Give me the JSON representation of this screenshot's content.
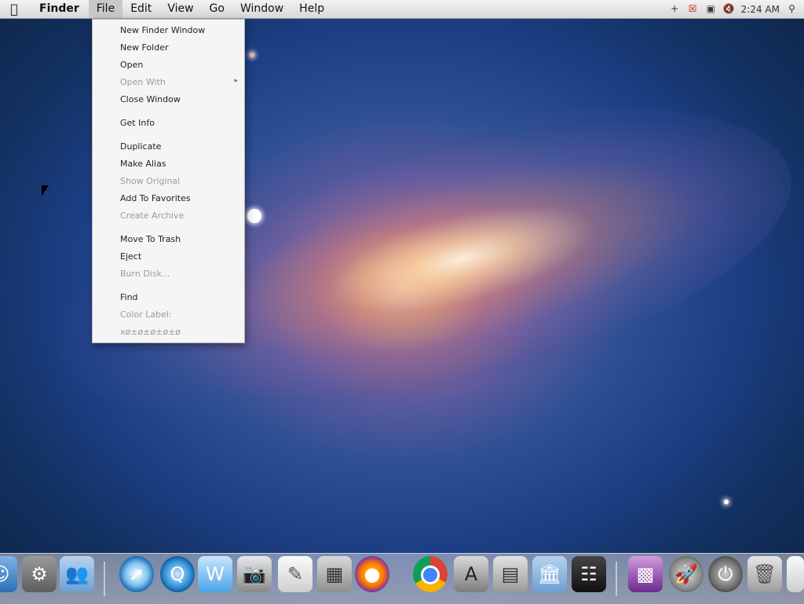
{
  "menubar": {
    "app_name": "Finder",
    "menus": [
      "File",
      "Edit",
      "View",
      "Go",
      "Window",
      "Help"
    ],
    "active_menu": "File",
    "clock": "2:24 AM"
  },
  "file_menu": {
    "items": [
      {
        "label": "New Finder Window",
        "enabled": true
      },
      {
        "label": "New Folder",
        "enabled": true
      },
      {
        "label": "Open",
        "enabled": true
      },
      {
        "label": "Open With",
        "enabled": false
      },
      {
        "label": "Close Window",
        "enabled": true
      },
      {
        "label": "Get Info",
        "enabled": true
      },
      {
        "label": "Duplicate",
        "enabled": true
      },
      {
        "label": "Make Alias",
        "enabled": true
      },
      {
        "label": "Show Original",
        "enabled": false
      },
      {
        "label": "Add To Favorites",
        "enabled": true
      },
      {
        "label": "Create Archive",
        "enabled": false
      },
      {
        "label": "Move To Trash",
        "enabled": true
      },
      {
        "label": "Eject",
        "enabled": true
      },
      {
        "label": "Burn Disk...",
        "enabled": false
      },
      {
        "label": "Find",
        "enabled": true
      },
      {
        "label": "Color Label:",
        "enabled": false
      },
      {
        "label": "xø±ø±ø±ø±ø",
        "enabled": false
      }
    ]
  },
  "dock": {
    "items": [
      "finder-icon",
      "system-preferences-icon",
      "users-folder-icon",
      "safari-icon",
      "quicktime-icon",
      "word-icon",
      "photo-icon",
      "textedit-icon",
      "calculator-icon",
      "firefox-icon",
      "chrome-icon",
      "app-store-icon",
      "disk-utility-icon",
      "applications-folder-icon",
      "dashboard-icon",
      "desktop-icon",
      "launchpad-icon",
      "power-icon",
      "trash-icon"
    ]
  }
}
